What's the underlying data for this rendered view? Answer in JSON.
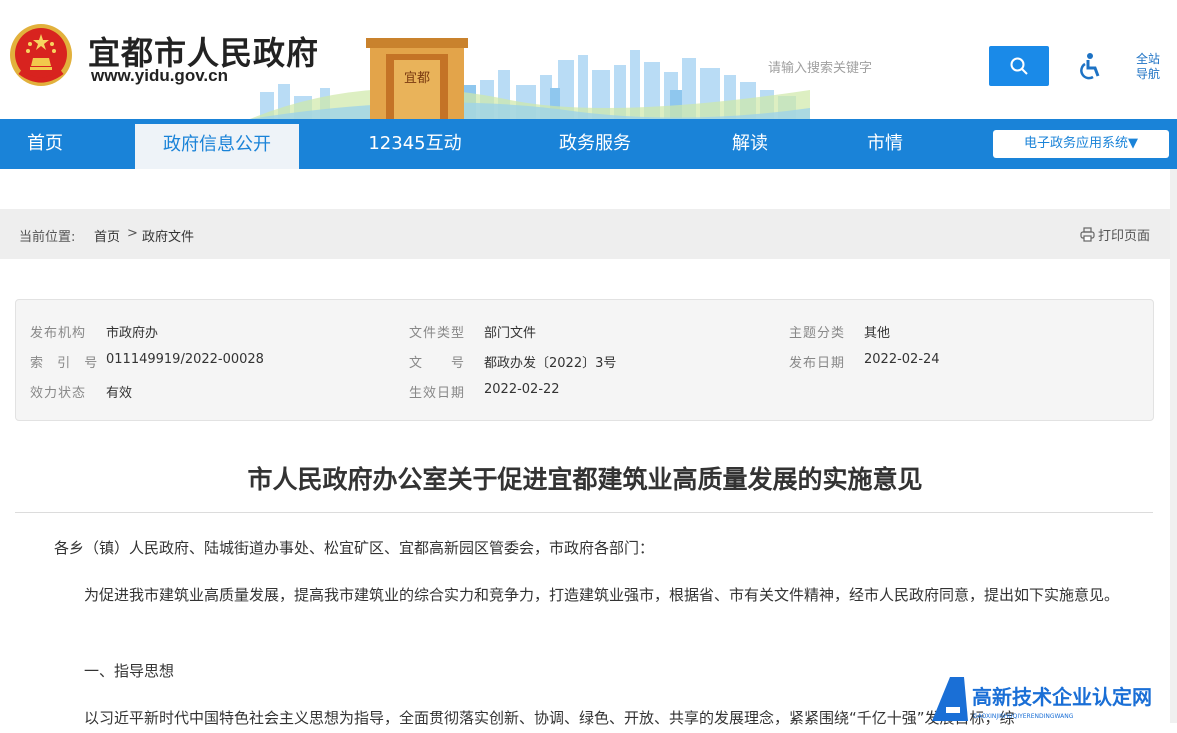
{
  "header": {
    "site_title": "宜都市人民政府",
    "site_url": "www.yidu.gov.cn",
    "gate_sign": "宜都",
    "search_placeholder": "请输入搜索关键字",
    "full_nav_label": "全站导航"
  },
  "nav": {
    "items": [
      {
        "label": "首页"
      },
      {
        "label": "政府信息公开",
        "active": true
      },
      {
        "label": "12345互动"
      },
      {
        "label": "政务服务"
      },
      {
        "label": "解读"
      },
      {
        "label": "市情"
      }
    ],
    "egov_label": "电子政务应用系统▼"
  },
  "breadcrumb": {
    "label": "当前位置:",
    "home": "首页",
    "separator": ">",
    "current": "政府文件",
    "print_label": "打印页面"
  },
  "meta": {
    "issuer_label": "发布机构",
    "issuer": "市政府办",
    "index_label": "索 引 号",
    "index": "011149919/2022-00028",
    "status_label": "效力状态",
    "status": "有效",
    "type_label": "文件类型",
    "type": "部门文件",
    "docno_label": "文　　号",
    "docno": "都政办发〔2022〕3号",
    "effective_label": "生效日期",
    "effective": "2022-02-22",
    "topic_label": "主题分类",
    "topic": "其他",
    "published_label": "发布日期",
    "published": "2022-02-24"
  },
  "article": {
    "title": "市人民政府办公室关于促进宜都建筑业高质量发展的实施意见",
    "salutation": "各乡（镇）人民政府、陆城街道办事处、松宜矿区、宜都高新园区管委会，市政府各部门：",
    "intro": "　　为促进我市建筑业高质量发展，提高我市建筑业的综合实力和竞争力，打造建筑业强市，根据省、市有关文件精神，经市人民政府同意，提出如下实施意见。",
    "section1": "　　一、指导思想",
    "section1_text": "　　以习近平新时代中国特色社会主义思想为指导，全面贯彻落实创新、协调、绿色、开放、共享的发展理念，紧紧围绕“千亿十强”发展目标，综"
  },
  "watermark": {
    "text": "高新技术企业认定网",
    "sub": "GAOXINJISHUQIYERENDINGWANG"
  }
}
